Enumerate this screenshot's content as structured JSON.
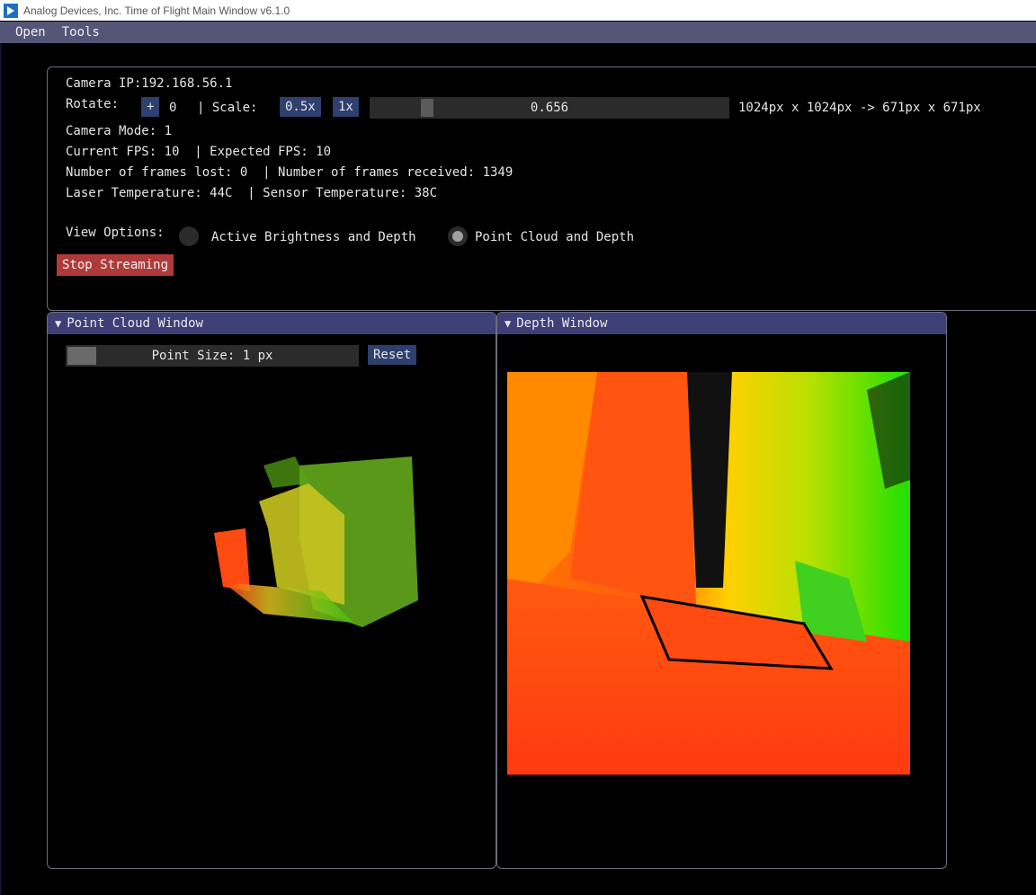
{
  "window_title": "Analog Devices, Inc. Time of Flight Main Window v6.1.0",
  "menu": [
    "Open",
    "Tools"
  ],
  "camera": {
    "ip_line": "Camera IP:192.168.56.1",
    "rotate_label": "Rotate:",
    "rotate_plus": "+",
    "rotate_value": "0",
    "scale_label": "| Scale:",
    "scale_half": "0.5x",
    "scale_one": "1x",
    "scale_value": "0.656",
    "resolution": "1024px x 1024px -> 671px x 671px",
    "mode_line": "Camera Mode: 1",
    "fps_line": "Current FPS: 10  | Expected FPS: 10",
    "frames_line": "Number of frames lost: 0  | Number of frames received: 1349",
    "temp_line": "Laser Temperature: 44C  | Sensor Temperature: 38C",
    "view_options_label": "View Options:",
    "view_option_1": "Active Brightness and Depth",
    "view_option_2": "Point Cloud and Depth",
    "selected_view": "Point Cloud and Depth",
    "stop_button": "Stop Streaming"
  },
  "point_cloud_window": {
    "title": "Point Cloud Window",
    "point_size_label": "Point Size: 1 px",
    "reset_button": "Reset"
  },
  "depth_window": {
    "title": "Depth Window"
  },
  "colors": {
    "menubar": "#555578",
    "window_header": "#3f3f78",
    "button": "#2f3f6e",
    "stop_button": "#b03a3a"
  }
}
